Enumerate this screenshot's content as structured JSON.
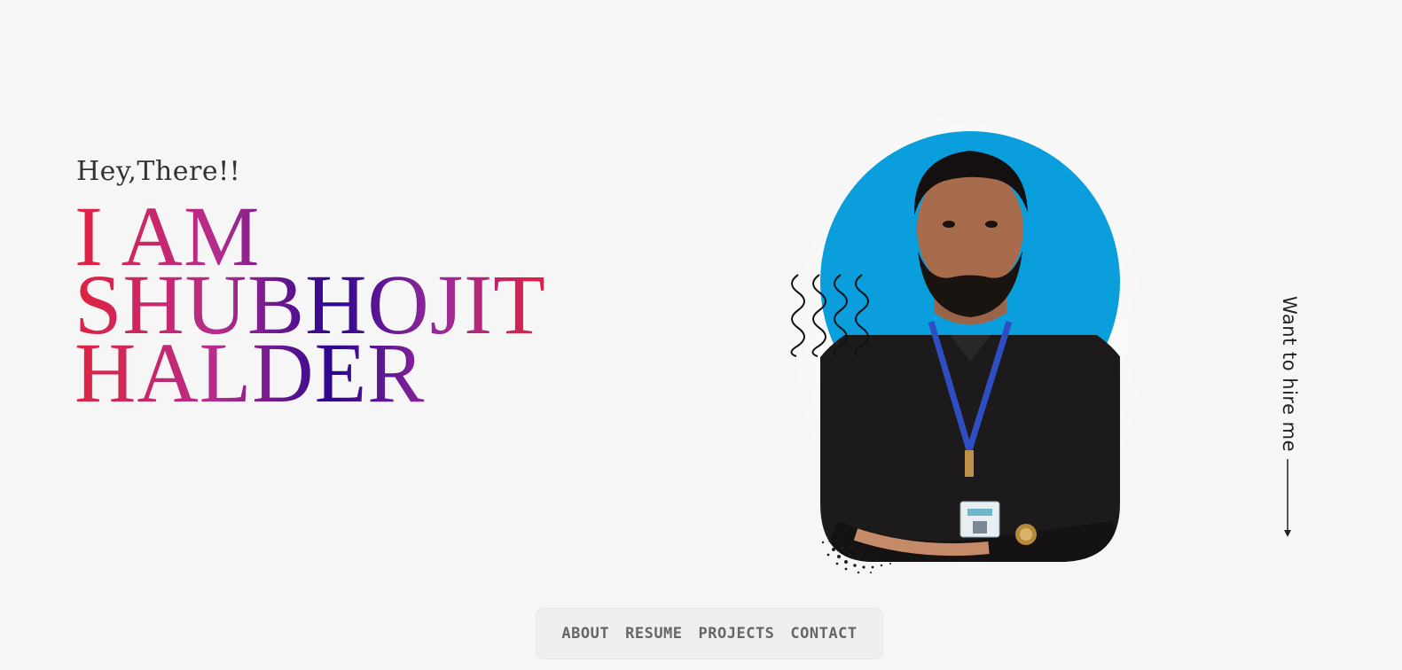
{
  "hero": {
    "greeting": "Hey,There!!",
    "headline_line1": "I AM",
    "headline_line2": "SHUBHOJIT",
    "headline_line3": "HALDER"
  },
  "portrait": {
    "background_color": "#0a9fdc",
    "decoration_left": "squiggle-lines-icon",
    "decoration_bottom": "halftone-dots-icon"
  },
  "sidebar_cta": {
    "label": "Want to hire me",
    "icon": "arrow-down-icon"
  },
  "nav": {
    "items": [
      {
        "label": "ABOUT"
      },
      {
        "label": "RESUME"
      },
      {
        "label": "PROJECTS"
      },
      {
        "label": "CONTACT"
      }
    ]
  },
  "colors": {
    "background": "#f6f6f6",
    "gradient_red": "#e0223f",
    "gradient_purple": "#2b0690",
    "gradient_magenta": "#b52c8c",
    "nav_text": "#666666"
  }
}
